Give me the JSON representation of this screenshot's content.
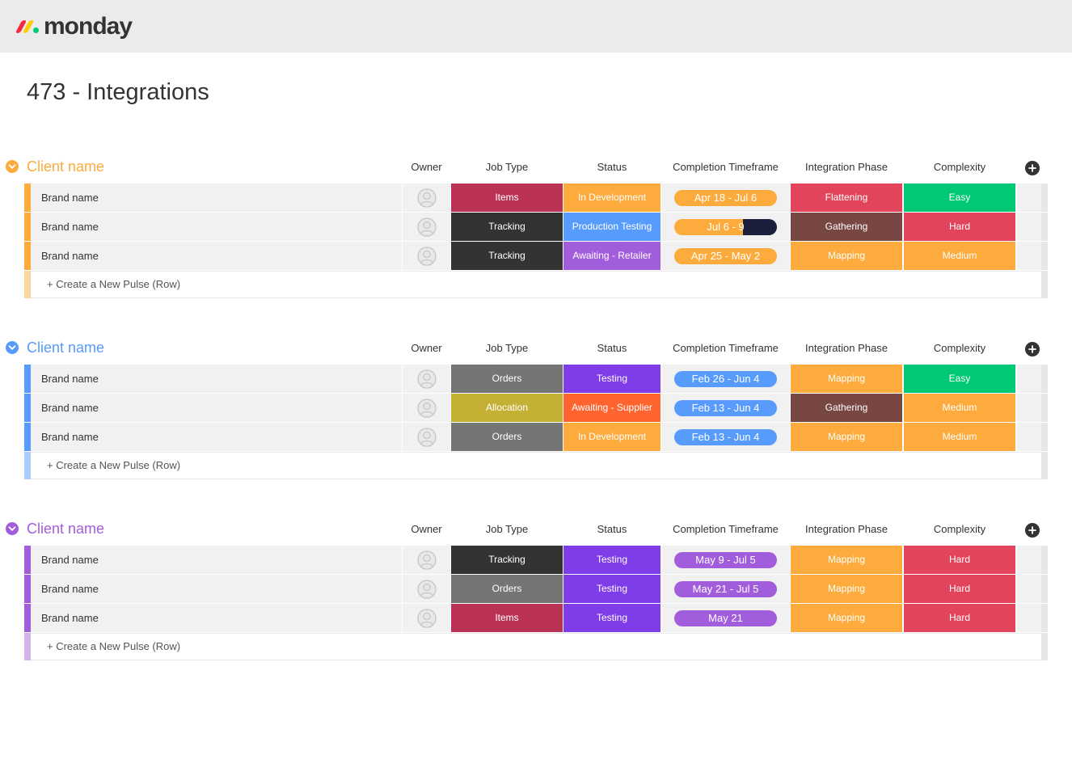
{
  "brand": {
    "name": "monday"
  },
  "board": {
    "title": "473 - Integrations"
  },
  "columns": {
    "owner": "Owner",
    "job_type": "Job Type",
    "status": "Status",
    "timeframe": "Completion Timeframe",
    "phase": "Integration Phase",
    "complexity": "Complexity"
  },
  "create_label": "+ Create a New Pulse (Row)",
  "groups": [
    {
      "name": "Client name",
      "color": "#fdab3d",
      "light": "#fdd59e",
      "rows": [
        {
          "name": "Brand name",
          "job_type": "Items",
          "job_color": "#bb3354",
          "status": "In Development",
          "status_color": "#fdab3d",
          "timeframe": "Apr 18 - Jul 6",
          "progress": 1.0,
          "phase": "Flattening",
          "phase_color": "#e2445c",
          "complexity": "Easy",
          "complexity_color": "#00c875"
        },
        {
          "name": "Brand name",
          "job_type": "Tracking",
          "job_color": "#333333",
          "status": "Production Testing",
          "status_color": "#579bfc",
          "timeframe": "Jul 6 - 9",
          "progress": 0.67,
          "phase": "Gathering",
          "phase_color": "#784743",
          "complexity": "Hard",
          "complexity_color": "#e2445c"
        },
        {
          "name": "Brand name",
          "job_type": "Tracking",
          "job_color": "#333333",
          "status": "Awaiting - Retailer",
          "status_color": "#a25ddc",
          "timeframe": "Apr 25 - May 2",
          "progress": 1.0,
          "phase": "Mapping",
          "phase_color": "#fdab3d",
          "complexity": "Medium",
          "complexity_color": "#fdab3d"
        }
      ]
    },
    {
      "name": "Client name",
      "color": "#579bfc",
      "light": "#abcdfd",
      "rows": [
        {
          "name": "Brand name",
          "job_type": "Orders",
          "job_color": "#757575",
          "status": "Testing",
          "status_color": "#7e3de8",
          "timeframe": "Feb 26 - Jun 4",
          "progress": 1.0,
          "phase": "Mapping",
          "phase_color": "#fdab3d",
          "complexity": "Easy",
          "complexity_color": "#00c875"
        },
        {
          "name": "Brand name",
          "job_type": "Allocation",
          "job_color": "#c4b034",
          "status": "Awaiting - Supplier",
          "status_color": "#ff642e",
          "timeframe": "Feb 13 - Jun 4",
          "progress": 1.0,
          "phase": "Gathering",
          "phase_color": "#784743",
          "complexity": "Medium",
          "complexity_color": "#fdab3d"
        },
        {
          "name": "Brand name",
          "job_type": "Orders",
          "job_color": "#757575",
          "status": "In Development",
          "status_color": "#fdab3d",
          "timeframe": "Feb 13 - Jun 4",
          "progress": 1.0,
          "phase": "Mapping",
          "phase_color": "#fdab3d",
          "complexity": "Medium",
          "complexity_color": "#fdab3d"
        }
      ]
    },
    {
      "name": "Client name",
      "color": "#a25ddc",
      "light": "#d3b4ee",
      "rows": [
        {
          "name": "Brand name",
          "job_type": "Tracking",
          "job_color": "#333333",
          "status": "Testing",
          "status_color": "#7e3de8",
          "timeframe": "May 9 - Jul 5",
          "progress": 1.0,
          "phase": "Mapping",
          "phase_color": "#fdab3d",
          "complexity": "Hard",
          "complexity_color": "#e2445c"
        },
        {
          "name": "Brand name",
          "job_type": "Orders",
          "job_color": "#757575",
          "status": "Testing",
          "status_color": "#7e3de8",
          "timeframe": "May 21 - Jul 5",
          "progress": 1.0,
          "phase": "Mapping",
          "phase_color": "#fdab3d",
          "complexity": "Hard",
          "complexity_color": "#e2445c"
        },
        {
          "name": "Brand name",
          "job_type": "Items",
          "job_color": "#bb3354",
          "status": "Testing",
          "status_color": "#7e3de8",
          "timeframe": "May 21",
          "progress": 1.0,
          "phase": "Mapping",
          "phase_color": "#fdab3d",
          "complexity": "Hard",
          "complexity_color": "#e2445c"
        }
      ]
    }
  ]
}
